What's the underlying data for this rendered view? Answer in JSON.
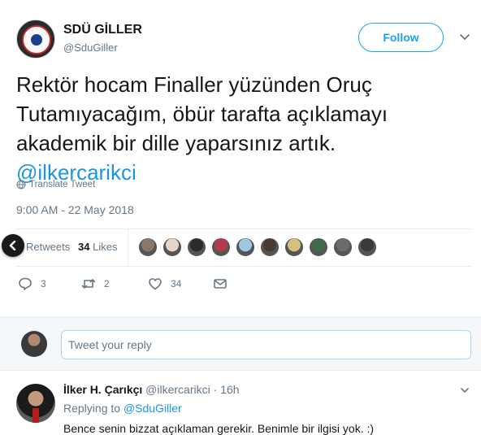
{
  "tweet": {
    "author_name": "SDÜ GİLLER",
    "author_handle": "@SduGiller",
    "follow_label": "Follow",
    "text_lines": [
      "Rektör hocam Finaller yüzünden Oruç",
      "Tutamıyacağım, öbür tarafta açıklamayı",
      "akademik bir dille yaparsınız artık."
    ],
    "mention": "@ilkercarikci",
    "translate_label": "Translate Tweet",
    "timestamp": "9:00 AM - 22 May 2018",
    "stats": {
      "retweets_label": "Retweets",
      "likes_count": "34",
      "likes_label": "Likes"
    },
    "liker_colors": [
      "#8a7768",
      "#e8d7c9",
      "#2b2b2b",
      "#b53a4b",
      "#9fc7e0",
      "#4a3b33",
      "#d6c07e",
      "#3d6b4a",
      "#6b6b6b",
      "#3a3a3a"
    ],
    "actions": {
      "reply_count": "3",
      "retweet_count": "2",
      "like_count": "34"
    }
  },
  "reply_box": {
    "placeholder": "Tweet your reply"
  },
  "reply_tweet": {
    "author_name": "İlker H. Çarıkçı",
    "author_handle": "@ilkercarikci",
    "time": "· 16h",
    "replying_prefix": "Replying to",
    "replying_to": "@SduGiller",
    "text": "Bence senin bizzat açıklaman gerekir. Benimle bir ilgisi yok. :)"
  },
  "colors": {
    "accent": "#1da1f2",
    "link": "#1b95e0",
    "muted": "#657786"
  }
}
